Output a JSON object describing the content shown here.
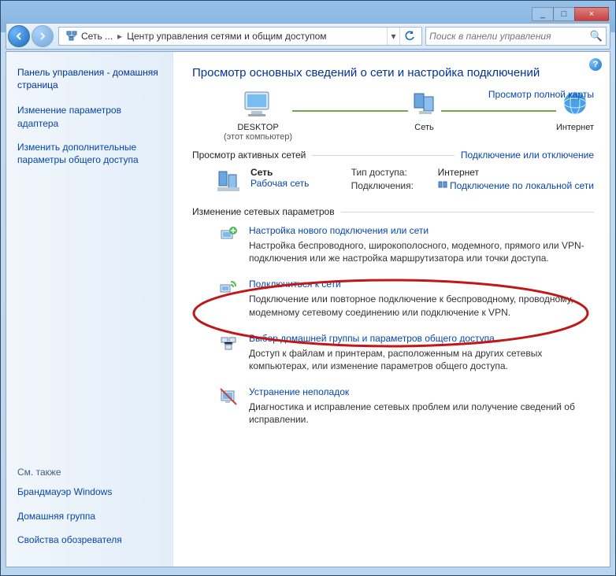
{
  "titlebar": {
    "min": "_",
    "max": "□",
    "close": "×"
  },
  "address": {
    "root_label": "Сеть ...",
    "path_label": "Центр управления сетями и общим доступом",
    "arrow": "▸",
    "dropdown": "▾",
    "refresh": "↻"
  },
  "search": {
    "placeholder": "Поиск в панели управления",
    "icon": "🔍"
  },
  "help": "?",
  "sidebar": {
    "home": "Панель управления - домашняя страница",
    "links": [
      "Изменение параметров адаптера",
      "Изменить дополнительные параметры общего доступа"
    ],
    "also_header": "См. также",
    "also_links": [
      "Брандмауэр Windows",
      "Домашняя группа",
      "Свойства обозревателя"
    ]
  },
  "main": {
    "title": "Просмотр основных сведений о сети и настройка подключений",
    "map_link": "Просмотр полной карты",
    "nodes": {
      "desktop": "DESKTOP",
      "desktop_sub": "(этот компьютер)",
      "network": "Сеть",
      "internet": "Интернет"
    },
    "active_nets": "Просмотр активных сетей",
    "connect_link": "Подключение или отключение",
    "net": {
      "name": "Сеть",
      "type": "Рабочая сеть",
      "access_lbl": "Тип доступа:",
      "access_val": "Интернет",
      "conn_lbl": "Подключения:",
      "conn_val": "Подключение по локальной сети"
    },
    "settings_hdr": "Изменение сетевых параметров",
    "tasks": [
      {
        "link": "Настройка нового подключения или сети",
        "desc": "Настройка беспроводного, широкополосного, модемного, прямого или VPN-подключения или же настройка маршрутизатора или точки доступа."
      },
      {
        "link": "Подключиться к сети",
        "desc": "Подключение или повторное подключение к беспроводному, проводному, модемному сетевому соединению или подключение к VPN."
      },
      {
        "link": "Выбор домашней группы и параметров общего доступа",
        "desc": "Доступ к файлам и принтерам, расположенным на других сетевых компьютерах, или изменение параметров общего доступа."
      },
      {
        "link": "Устранение неполадок",
        "desc": "Диагностика и исправление сетевых проблем или получение сведений об исправлении."
      }
    ]
  }
}
